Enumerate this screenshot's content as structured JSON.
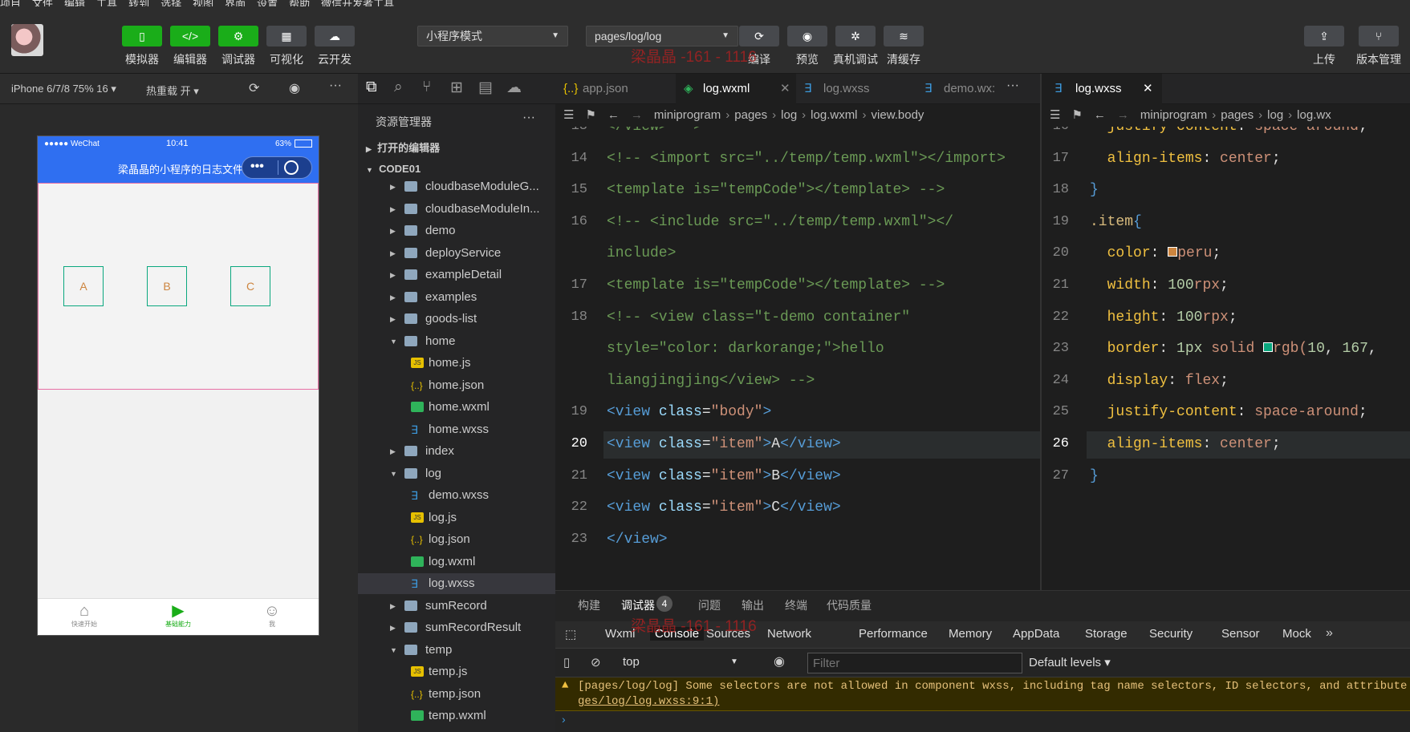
{
  "menubar": [
    "项目",
    "文件",
    "编辑",
    "工具",
    "转到",
    "选择",
    "视图",
    "界面",
    "设置",
    "帮助",
    "微信开发者工具"
  ],
  "title_watermark": "梁晶晶 -161 - 1116",
  "toolbar": {
    "left_buttons": [
      {
        "label": "模拟器",
        "icon": "▯"
      },
      {
        "label": "编辑器",
        "icon": "</>"
      },
      {
        "label": "调试器",
        "icon": "⚙"
      },
      {
        "label": "可视化",
        "icon": "▦"
      },
      {
        "label": "云开发",
        "icon": "☁"
      }
    ],
    "mode_select": "小程序模式",
    "page_select": "pages/log/log",
    "mid_buttons": [
      {
        "label": "编译",
        "icon": "⟳"
      },
      {
        "label": "预览",
        "icon": "◉"
      },
      {
        "label": "真机调试",
        "icon": "✲"
      },
      {
        "label": "清缓存",
        "icon": "≋"
      }
    ],
    "right_buttons": [
      {
        "label": "上传",
        "icon": "⇪"
      },
      {
        "label": "版本管理",
        "icon": "⑂"
      }
    ]
  },
  "simulator": {
    "device": "iPhone 6/7/8 75% 16",
    "hot_reload": "热重载 开",
    "status": {
      "carrier": "●●●●● WeChat",
      "time": "10:41",
      "battery": "63%"
    },
    "nav_title": "梁晶晶的小程序的日志文件",
    "items": [
      "A",
      "B",
      "C"
    ],
    "tabs": [
      {
        "label": "快速开始",
        "icon": "⌂"
      },
      {
        "label": "基础能力",
        "icon": "▶"
      },
      {
        "label": "我",
        "icon": "☺"
      }
    ],
    "colors": {
      "nav": "#2f6ff1",
      "item_text": "#cd853f",
      "item_border": "#0aa77e",
      "tab_active": "#1aad19"
    }
  },
  "explorer": {
    "title": "资源管理器",
    "open_editors": "打开的编辑器",
    "root": "CODE01",
    "tree": [
      {
        "name": "cloudbaseModuleG...",
        "kind": "folder",
        "depth": 1
      },
      {
        "name": "cloudbaseModuleIn...",
        "kind": "folder",
        "depth": 1
      },
      {
        "name": "demo",
        "kind": "folder",
        "depth": 1
      },
      {
        "name": "deployService",
        "kind": "folder",
        "depth": 1
      },
      {
        "name": "exampleDetail",
        "kind": "folder",
        "depth": 1
      },
      {
        "name": "examples",
        "kind": "folder",
        "depth": 1
      },
      {
        "name": "goods-list",
        "kind": "folder",
        "depth": 1
      },
      {
        "name": "home",
        "kind": "folder-open",
        "depth": 1
      },
      {
        "name": "home.js",
        "kind": "js",
        "depth": 2
      },
      {
        "name": "home.json",
        "kind": "json",
        "depth": 2
      },
      {
        "name": "home.wxml",
        "kind": "wxml",
        "depth": 2
      },
      {
        "name": "home.wxss",
        "kind": "wxss",
        "depth": 2
      },
      {
        "name": "index",
        "kind": "folder",
        "depth": 1
      },
      {
        "name": "log",
        "kind": "folder-open",
        "depth": 1
      },
      {
        "name": "demo.wxss",
        "kind": "wxss",
        "depth": 2
      },
      {
        "name": "log.js",
        "kind": "js",
        "depth": 2
      },
      {
        "name": "log.json",
        "kind": "json",
        "depth": 2
      },
      {
        "name": "log.wxml",
        "kind": "wxml",
        "depth": 2
      },
      {
        "name": "log.wxss",
        "kind": "wxss",
        "depth": 2,
        "selected": true
      },
      {
        "name": "sumRecord",
        "kind": "folder",
        "depth": 1
      },
      {
        "name": "sumRecordResult",
        "kind": "folder",
        "depth": 1
      },
      {
        "name": "temp",
        "kind": "folder-open",
        "depth": 1
      },
      {
        "name": "temp.js",
        "kind": "js",
        "depth": 2
      },
      {
        "name": "temp.json",
        "kind": "json",
        "depth": 2
      },
      {
        "name": "temp.wxml",
        "kind": "wxml",
        "depth": 2
      }
    ]
  },
  "editor_left": {
    "tabs": [
      {
        "label": "app.json",
        "icon": "{..}"
      },
      {
        "label": "log.wxml",
        "icon": "◈",
        "active": true
      },
      {
        "label": "log.wxss",
        "icon": "∃"
      },
      {
        "label": "demo.wx:",
        "icon": "∃"
      }
    ],
    "breadcrumb": [
      "miniprogram",
      "pages",
      "log",
      "log.wxml",
      "view.body"
    ],
    "lines": [
      {
        "n": "13",
        "html": "<span class='cm'>&lt;/view&gt; --&gt;</span>"
      },
      {
        "n": "14",
        "html": "<span class='cm'>&lt;!-- &lt;import src=\"../temp/temp.wxml\"&gt;&lt;/import&gt;</span>"
      },
      {
        "n": "15",
        "html": "<span class='cm'>&lt;template is=\"tempCode\"&gt;&lt;/template&gt; --&gt;</span>"
      },
      {
        "n": "16",
        "html": "<span class='cm'>&lt;!-- &lt;include src=\"../temp/temp.wxml\"&gt;&lt;/</span>"
      },
      {
        "n": "",
        "html": "<span class='cm'>include&gt;</span>"
      },
      {
        "n": "17",
        "html": "<span class='cm'>&lt;template is=\"tempCode\"&gt;&lt;/template&gt; --&gt;</span>"
      },
      {
        "n": "18",
        "html": "<span class='cm'>&lt;!-- &lt;view class=\"t-demo container\"</span>"
      },
      {
        "n": "",
        "html": "<span class='cm'>style=\"color: darkorange;\"&gt;hello</span>"
      },
      {
        "n": "",
        "html": "<span class='cm'>liangjingjing&lt;/view&gt; --&gt;</span>"
      },
      {
        "n": "19",
        "html": "<span class='tg'>&lt;view</span> <span class='at'>class</span>=<span class='st'>\"body\"</span><span class='tg'>&gt;</span>"
      },
      {
        "n": "20",
        "html": "<span class='tg'>&lt;view</span> <span class='at'>class</span>=<span class='st'>\"item\"</span><span class='tg'>&gt;</span>A<span class='tg'>&lt;/view&gt;</span>"
      },
      {
        "n": "21",
        "html": "<span class='tg'>&lt;view</span> <span class='at'>class</span>=<span class='st'>\"item\"</span><span class='tg'>&gt;</span>B<span class='tg'>&lt;/view&gt;</span>"
      },
      {
        "n": "22",
        "html": "<span class='tg'>&lt;view</span> <span class='at'>class</span>=<span class='st'>\"item\"</span><span class='tg'>&gt;</span>C<span class='tg'>&lt;/view&gt;</span>"
      },
      {
        "n": "23",
        "html": "<span class='tg'>&lt;/view&gt;</span>"
      }
    ]
  },
  "editor_right": {
    "tab": "log.wxss",
    "breadcrumb": [
      "miniprogram",
      "pages",
      "log",
      "log.wx"
    ],
    "lines": [
      {
        "n": "16",
        "html": "  <span class='pr'>justify-content</span>: <span class='vl'>space-around</span>;"
      },
      {
        "n": "17",
        "html": "  <span class='pr'>align-items</span>: <span class='vl'>center</span>;"
      },
      {
        "n": "18",
        "html": "<span class='tg'>}</span>"
      },
      {
        "n": "19",
        "html": "<span class='sel2'>.item</span><span class='tg'>{</span>"
      },
      {
        "n": "20",
        "html": "  <span class='pr'>color</span>: <span style='display:inline-block;width:12px;height:12px;background:#cd853f;border:1px solid #fff'></span><span class='vl'>peru</span>;"
      },
      {
        "n": "21",
        "html": "  <span class='pr'>width</span>: <span class='nm'>100</span><span class='vl'>rpx</span>;"
      },
      {
        "n": "22",
        "html": "  <span class='pr'>height</span>: <span class='nm'>100</span><span class='vl'>rpx</span>;"
      },
      {
        "n": "23",
        "html": "  <span class='pr'>border</span>: <span class='nm'>1px</span> <span class='vl'>solid</span> <span style='display:inline-block;width:12px;height:12px;background:#0aa77e;border:1px solid #fff'></span><span class='vl'>rgb(</span><span class='nm'>10</span>, <span class='nm'>167</span>,"
      },
      {
        "n": "24",
        "html": "  <span class='pr'>display</span>: <span class='vl'>flex</span>;"
      },
      {
        "n": "25",
        "html": "  <span class='pr'>justify-content</span>: <span class='vl'>space-around</span>;"
      },
      {
        "n": "26",
        "html": "  <span class='pr'>align-items</span>: <span class='vl'>center</span>;"
      },
      {
        "n": "27",
        "html": "<span class='tg'>}</span>"
      }
    ]
  },
  "debug_tabs": [
    "构建",
    "调试器",
    "问题",
    "输出",
    "终端",
    "代码质量"
  ],
  "debug_badge": "4",
  "console_tabs": [
    "Wxml",
    "Console",
    "Sources",
    "Network",
    "Performance",
    "Memory",
    "AppData",
    "Storage",
    "Security",
    "Sensor",
    "Mock"
  ],
  "console": {
    "context": "top",
    "filter_placeholder": "Filter",
    "levels": "Default levels",
    "warning_line1": "[pages/log/log] Some selectors are not allowed in component wxss, including tag name selectors, ID selectors, and attribute s",
    "warning_line2": "ges/log/log.wxss:9:1)"
  }
}
